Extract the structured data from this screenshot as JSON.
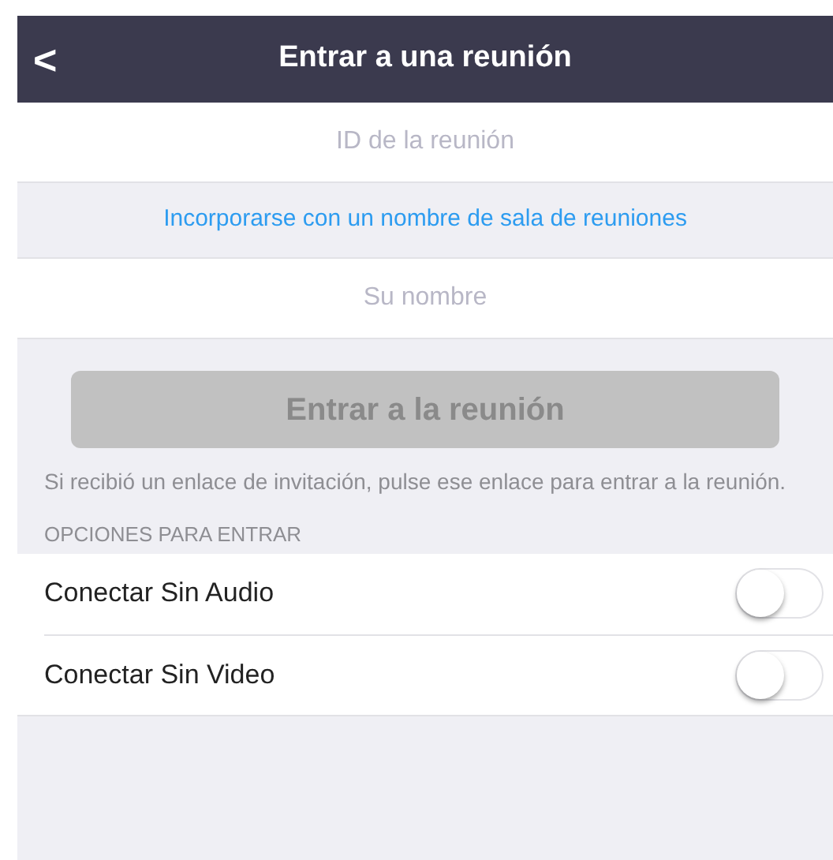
{
  "header": {
    "title": "Entrar a una reunión",
    "back": "<"
  },
  "fields": [
    {
      "placeholder": "ID de la reunión"
    },
    {
      "kind": "link",
      "label": "Incorporarse con un nombre de sala de reuniones"
    },
    {
      "placeholder": "Su nombre"
    }
  ],
  "join_button": {
    "label": "Entrar a la reunión",
    "disabled": true
  },
  "hint": "Si recibió un enlace de invitación, pulse ese enlace para entrar a la reunión.",
  "options": {
    "heading": "OPCIONES PARA ENTRAR",
    "items": [
      {
        "label": "Conectar Sin Audio",
        "on": false
      },
      {
        "label": "Conectar Sin Video",
        "on": false
      }
    ]
  }
}
